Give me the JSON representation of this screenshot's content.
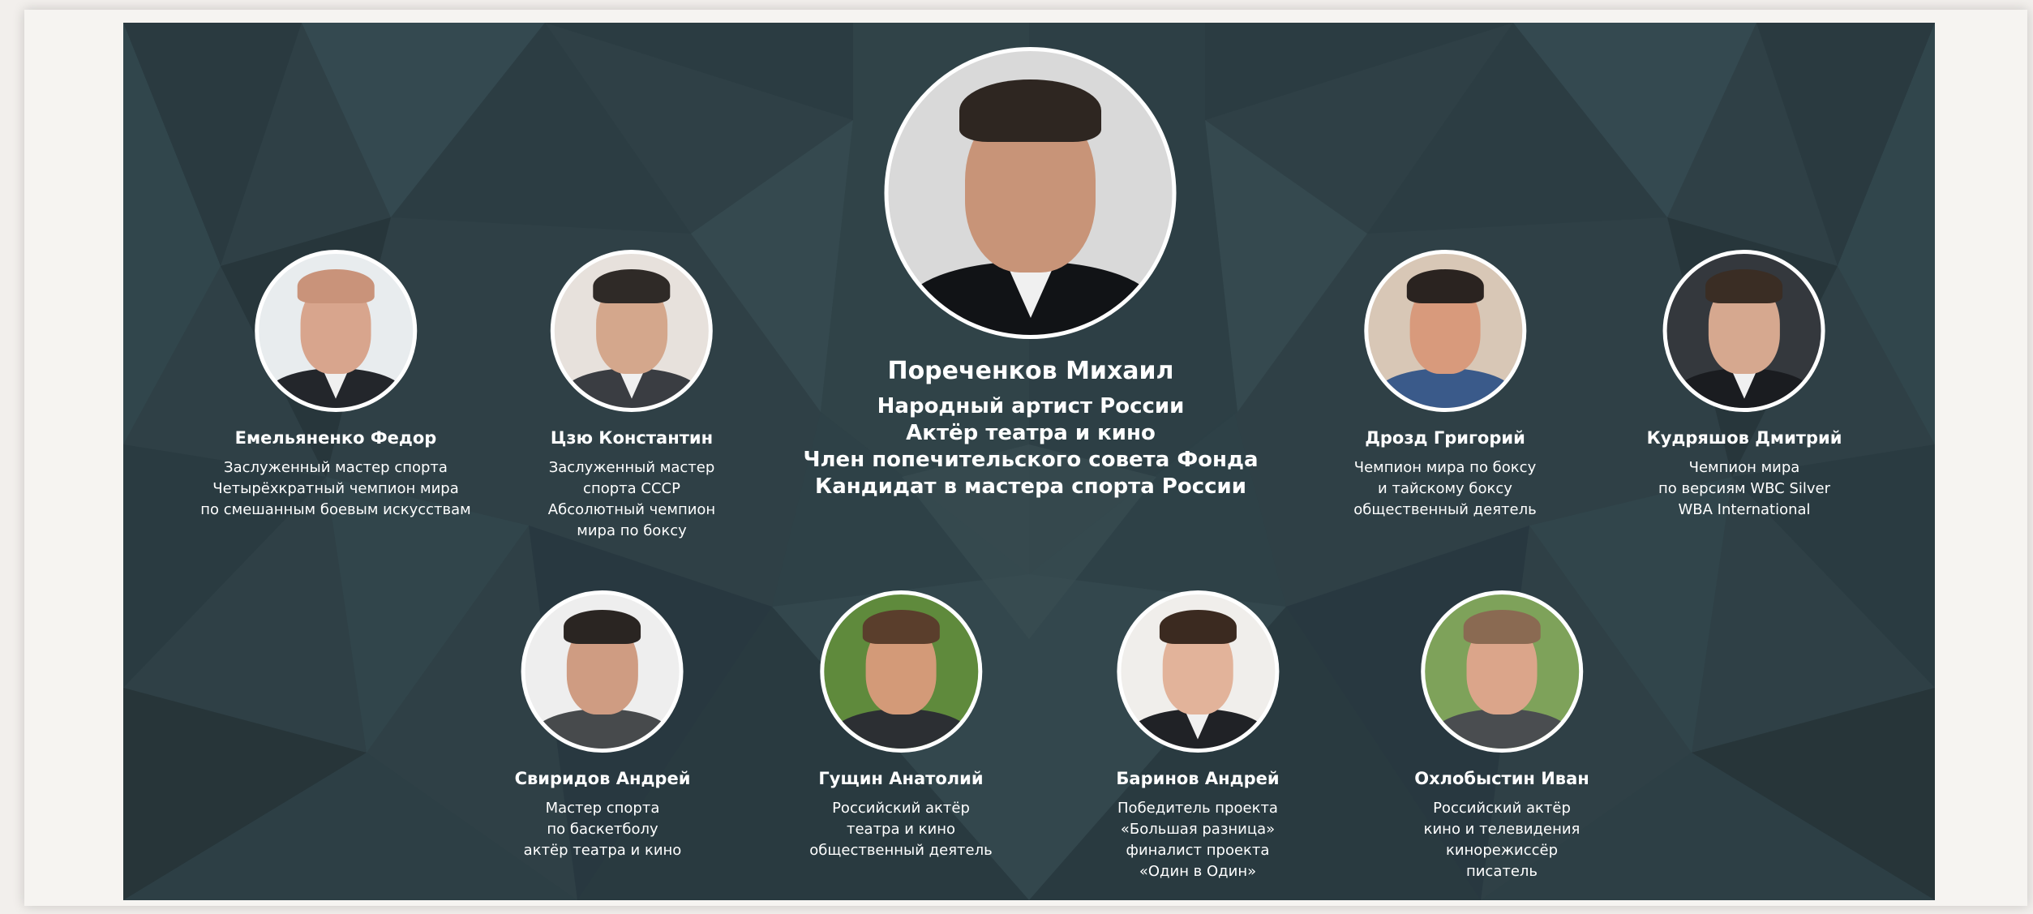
{
  "people": {
    "porechenkov": {
      "name": "Пореченков Михаил",
      "lines": [
        "Народный артист России",
        "Актёр театра и кино",
        "Член попечительского совета Фонда",
        "Кандидат в мастера спорта России"
      ],
      "photo": {
        "skin": "#c89478",
        "hair": "#2e2621",
        "suit": "#111316",
        "bg": "#d9d9d9"
      }
    },
    "emelianenko": {
      "name": "Емельяненко Федор",
      "lines": [
        "Заслуженный мастер спорта",
        "Четырёхкратный чемпион мира",
        "по смешанным боевым искусствам"
      ],
      "photo": {
        "skin": "#d8a58d",
        "hair": "#d8a58d",
        "suit": "#23262b",
        "bg": "#e8ecee"
      }
    },
    "tszyu": {
      "name": "Цзю Константин",
      "lines": [
        "Заслуженный мастер",
        "спорта СССР",
        "Абсолютный чемпион",
        "мира по боксу"
      ],
      "photo": {
        "skin": "#d4a78c",
        "hair": "#2f2a27",
        "suit": "#3a3d42",
        "bg": "#e7e1dc"
      }
    },
    "drozd": {
      "name": "Дрозд Григорий",
      "lines": [
        "Чемпион мира по боксу",
        "и тайскому боксу",
        "общественный деятель"
      ],
      "photo": {
        "skin": "#d89a7c",
        "hair": "#2a2320",
        "suit": "#3a5a8a",
        "bg": "#d8c7b6"
      }
    },
    "kudryashov": {
      "name": "Кудряшов Дмитрий",
      "lines": [
        "Чемпион мира",
        "по версиям WBC Silver",
        "WBA International"
      ],
      "photo": {
        "skin": "#d6a88f",
        "hair": "#3a2d24",
        "suit": "#1a1c20",
        "bg": "#34383d"
      }
    },
    "sviridov": {
      "name": "Свиридов Андрей",
      "lines": [
        "Мастер спорта",
        "по баскетболу",
        "актёр театра и кино"
      ],
      "photo": {
        "skin": "#cf9c82",
        "hair": "#2a2522",
        "suit": "#474a4c",
        "bg": "#eeeeee"
      }
    },
    "gushchin": {
      "name": "Гущин Анатолий",
      "lines": [
        "Российский актёр",
        "театра и кино",
        "общественный деятель"
      ],
      "photo": {
        "skin": "#d39a78",
        "hair": "#5a3e2c",
        "suit": "#2c2f33",
        "bg": "#5f8a3c"
      }
    },
    "barinov": {
      "name": "Баринов Андрей",
      "lines": [
        "Победитель проекта",
        "«Большая разница»",
        "финалист проекта",
        "«Один в Один»"
      ],
      "photo": {
        "skin": "#e2b39a",
        "hair": "#3b2a20",
        "suit": "#202226",
        "bg": "#f0eeeb"
      }
    },
    "okhlobystin": {
      "name": "Охлобыстин Иван",
      "lines": [
        "Российский актёр",
        "кино и телевидения",
        "кинорежиссёр",
        "писатель"
      ],
      "photo": {
        "skin": "#dba58a",
        "hair": "#8a6a52",
        "suit": "#4a4d50",
        "bg": "#7ea25a"
      }
    }
  }
}
